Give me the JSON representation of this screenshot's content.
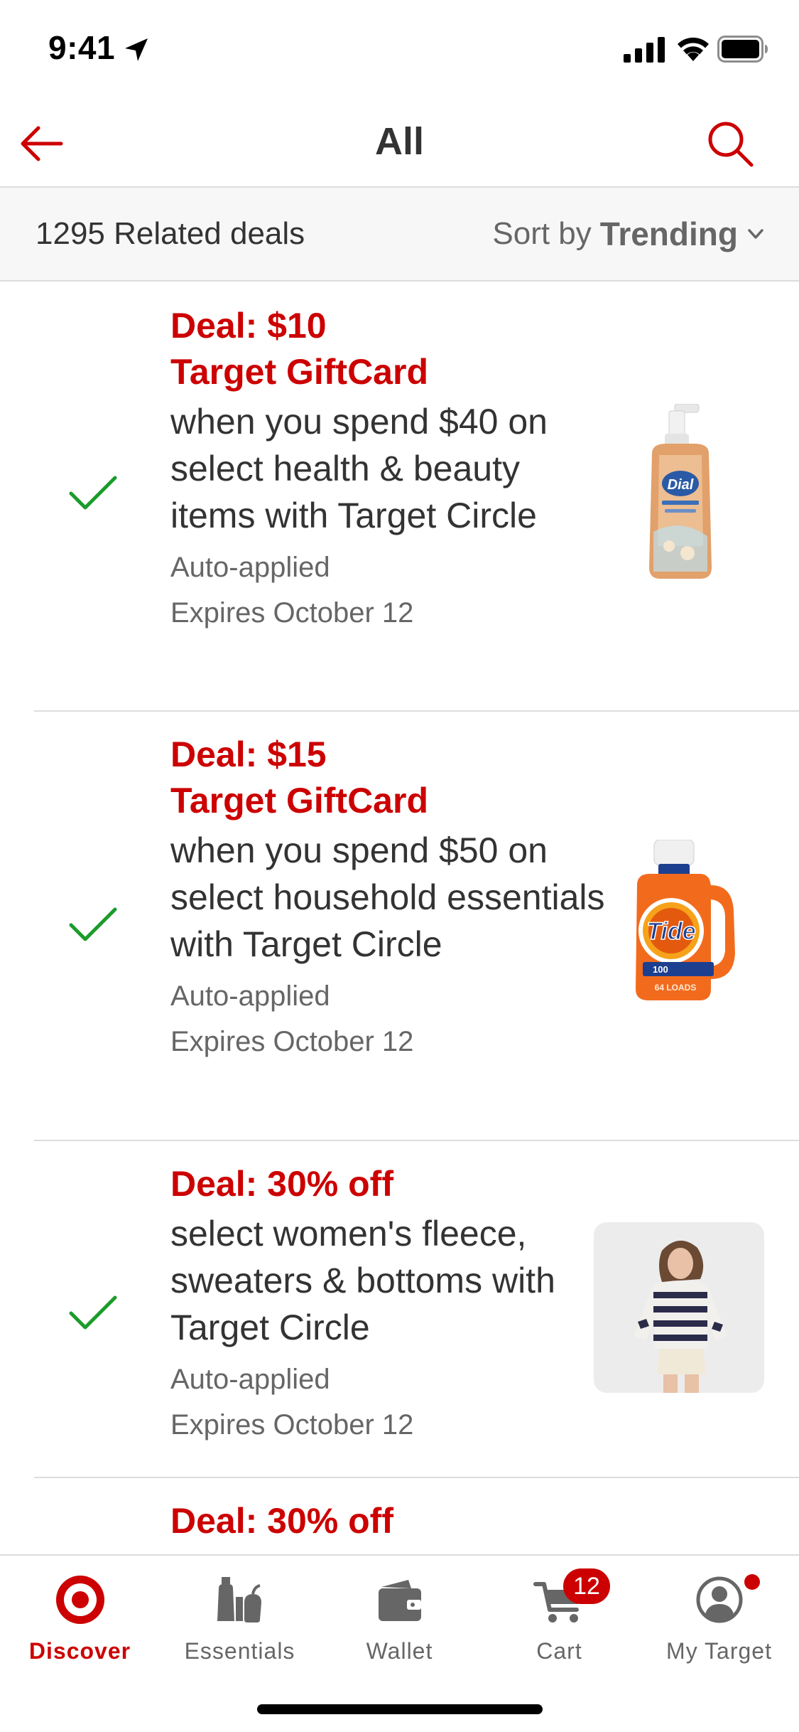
{
  "status_bar": {
    "time": "9:41"
  },
  "header": {
    "title": "All"
  },
  "sort_bar": {
    "deal_count": "1295 Related deals",
    "sort_prefix": "Sort by",
    "sort_value": "Trending"
  },
  "deals": [
    {
      "title": "Deal: $10\nTarget GiftCard",
      "title_line1": "Deal: $10",
      "title_line2": "Target GiftCard",
      "description": "when you spend $40 on select health & beauty items with Target Circle",
      "status": "Auto-applied",
      "expires": "Expires October 12",
      "image": "dial-soap-bottle"
    },
    {
      "title_line1": "Deal: $15",
      "title_line2": "Target GiftCard",
      "description": "when you spend $50 on select household essentials with Target Circle",
      "status": "Auto-applied",
      "expires": "Expires October 12",
      "image": "tide-detergent-bottle"
    },
    {
      "title_line1": "Deal: 30% off",
      "description": "select women's fleece, sweaters & bottoms with Target Circle",
      "status": "Auto-applied",
      "expires": "Expires October 12",
      "image": "striped-sweater-model"
    },
    {
      "title_line1": "Deal: 30% off"
    }
  ],
  "product_image_text": {
    "dial_brand": "Dial",
    "tide_brand": "Tide",
    "tide_loads": "64 LOADS",
    "tide_count": "100"
  },
  "tab_bar": {
    "tabs": [
      {
        "label": "Discover",
        "icon": "target-bullseye-icon",
        "active": true
      },
      {
        "label": "Essentials",
        "icon": "essentials-icon"
      },
      {
        "label": "Wallet",
        "icon": "wallet-icon"
      },
      {
        "label": "Cart",
        "icon": "cart-icon",
        "badge": "12"
      },
      {
        "label": "My Target",
        "icon": "account-icon"
      }
    ]
  },
  "colors": {
    "brand_red": "#cc0000",
    "check_green": "#1a9c2a",
    "text_dark": "#333333",
    "text_gray": "#666666",
    "divider": "#dcdcdc"
  }
}
